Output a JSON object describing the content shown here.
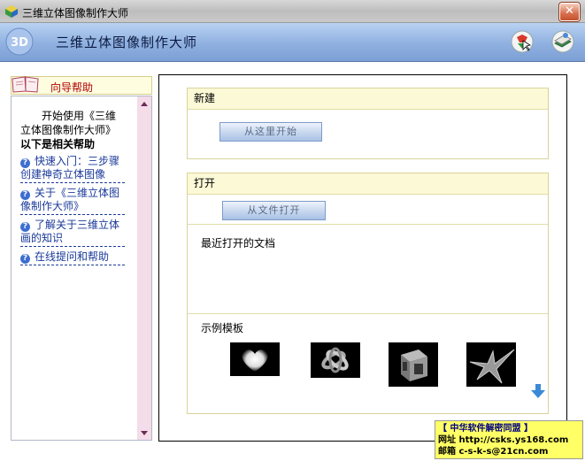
{
  "window": {
    "title": "三维立体图像制作大师",
    "close_glyph": "✕"
  },
  "banner": {
    "logo_text": "3D",
    "title": "三维立体图像制作大师",
    "icons": [
      "globe-cursor-icon",
      "book-globe-icon"
    ]
  },
  "sidebar": {
    "header": "向导帮助",
    "intro": "开始使用《三维立体图像制作大师》",
    "subtitle": "以下是相关帮助",
    "links": [
      {
        "label": "快速入门：三步骤创建神奇立体图像"
      },
      {
        "label": "关于《三维立体图像制作大师》"
      },
      {
        "label": "了解关于三维立体画的知识"
      },
      {
        "label": "在线提问和帮助"
      }
    ]
  },
  "new_section": {
    "title": "新建",
    "button": "从这里开始"
  },
  "open_section": {
    "title": "打开",
    "button": "从文件打开",
    "recent_label": "最近打开的文档",
    "templates_label": "示例模板"
  },
  "templates": [
    {
      "name": "heart-thumbnail"
    },
    {
      "name": "knot-thumbnail"
    },
    {
      "name": "cube-thumbnail"
    },
    {
      "name": "star-thumbnail"
    }
  ],
  "info_box": {
    "line1": "【 中华软件解密同盟 】",
    "line2": "网址  http://csks.ys168.com",
    "line3": "邮箱  c-s-k-s@21cn.com"
  },
  "colors": {
    "sidebar_header_text": "#b00000",
    "link": "#1a3a9a",
    "info_box_bg": "#ffff66"
  }
}
